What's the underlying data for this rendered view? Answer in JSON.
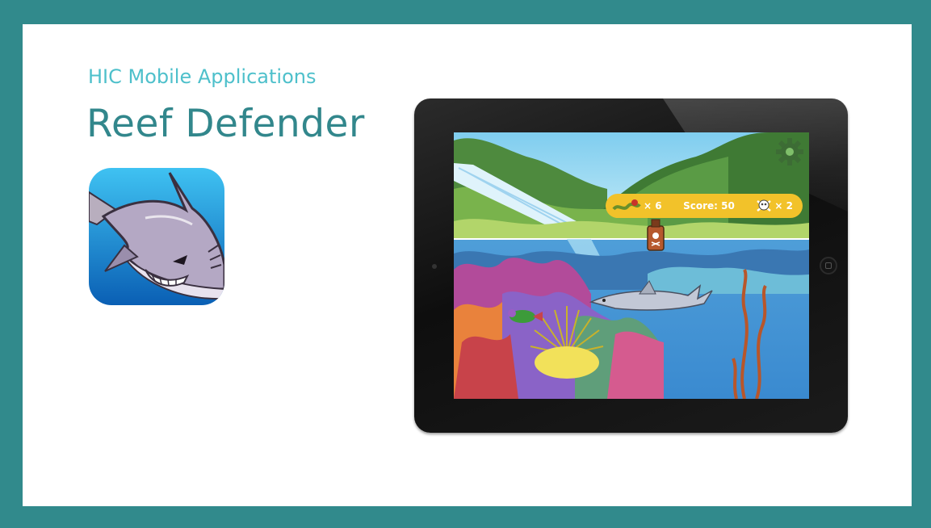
{
  "header": {
    "subtitle": "HIC Mobile Applications",
    "title": "Reef Defender"
  },
  "game_hud": {
    "seaweed_count": "× 6",
    "score_label": "Score: 50",
    "skull_count": "× 2"
  },
  "icons": {
    "app_icon": "shark-app-icon",
    "settings": "gear-icon",
    "seaweed": "seaweed-icon",
    "skull": "skull-crossbones-icon",
    "poison_bottle": "poison-bottle-icon"
  },
  "colors": {
    "frame": "#318a8c",
    "subtitle": "#4ec0cb",
    "title": "#32878c",
    "hud": "#f2c22a"
  }
}
